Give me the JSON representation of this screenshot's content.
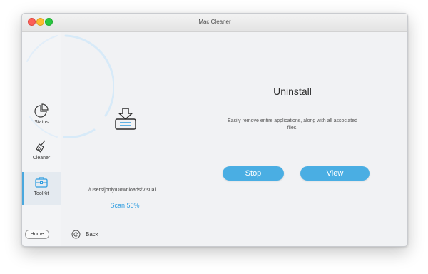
{
  "window": {
    "title": "Mac Cleaner"
  },
  "sidebar": {
    "items": [
      {
        "label": "Status",
        "icon": "pie-chart-icon"
      },
      {
        "label": "Cleaner",
        "icon": "broom-icon"
      },
      {
        "label": "ToolKit",
        "icon": "toolbox-icon",
        "active": true
      }
    ],
    "home_label": "Home"
  },
  "progress": {
    "path": "/Users/jonly/Downloads/Visual ...",
    "status": "Scan 56%",
    "percent": 56
  },
  "back": {
    "label": "Back"
  },
  "tool": {
    "title": "Uninstall",
    "description": "Easily remove entire applications, along with all associated files.",
    "stop_label": "Stop",
    "view_label": "View"
  },
  "colors": {
    "accent": "#4aaee3",
    "text_accent": "#2f9de0",
    "ring": "#d5e9f7"
  }
}
